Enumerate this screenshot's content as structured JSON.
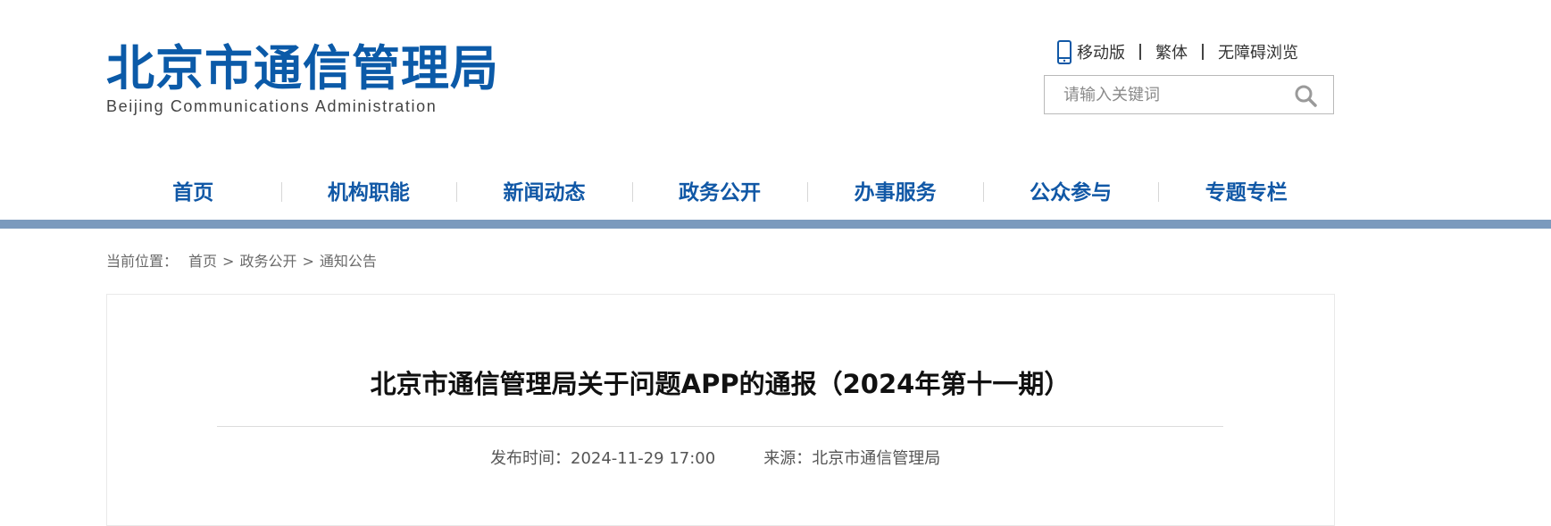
{
  "header": {
    "logo_cn": "北京市通信管理局",
    "logo_en": "Beijing Communications Administration",
    "links": {
      "mobile": "移动版",
      "traditional": "繁体",
      "accessible": "无障碍浏览"
    },
    "search": {
      "placeholder": "请输入关键词"
    }
  },
  "nav": {
    "items": [
      "首页",
      "机构职能",
      "新闻动态",
      "政务公开",
      "办事服务",
      "公众参与",
      "专题专栏"
    ]
  },
  "breadcrumb": {
    "label": "当前位置：",
    "items": [
      "首页",
      "政务公开",
      "通知公告"
    ],
    "separator": ">"
  },
  "article": {
    "title": "北京市通信管理局关于问题APP的通报（2024年第十一期）",
    "publish_label": "发布时间：",
    "publish_time": "2024-11-29 17:00",
    "source_label": "来源：",
    "source": "北京市通信管理局"
  },
  "colors": {
    "brand": "#0b5aa8",
    "nav_text": "#1158a6",
    "nav_bar": "#7b9abd"
  },
  "icons": {
    "mobile": "phone-icon",
    "search": "search-icon"
  }
}
